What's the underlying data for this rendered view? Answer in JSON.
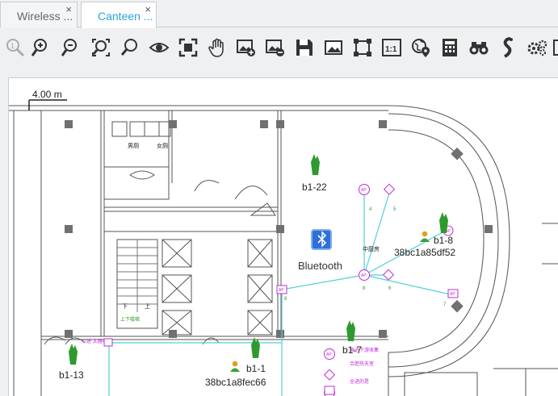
{
  "tabs": [
    {
      "label": "Wireless ...",
      "close": "×"
    },
    {
      "label": "Canteen ...",
      "close": "×"
    }
  ],
  "toolbar_icons": [
    "zoom-reset-icon",
    "zoom-in-icon",
    "zoom-out-icon",
    "zoom-fit-icon",
    "zoom-search-icon",
    "eye-icon",
    "fullscreen-icon",
    "pan-hand-icon",
    "add-image-icon",
    "remove-image-icon",
    "save-icon",
    "image-icon",
    "select-area-icon",
    "actual-size-icon",
    "location-pin-icon",
    "calculator-icon",
    "binoculars-icon",
    "signal-path-icon",
    "settings-icon"
  ],
  "map": {
    "scale": "4.00 m",
    "bluetooth_label": "Bluetooth",
    "aps": [
      {
        "name": "b1-22"
      },
      {
        "name": "b1-8",
        "client": "38bc1a85df52"
      },
      {
        "name": "b1-7"
      },
      {
        "name": "b1-1",
        "client": "38bc1a8fec66"
      },
      {
        "name": "b1-13"
      }
    ]
  },
  "colors": {
    "accent": "#29a3dd",
    "link_line": "#4fd1d8",
    "ap_marker": "#c02bd9",
    "ap_green": "#2e9a2e"
  }
}
